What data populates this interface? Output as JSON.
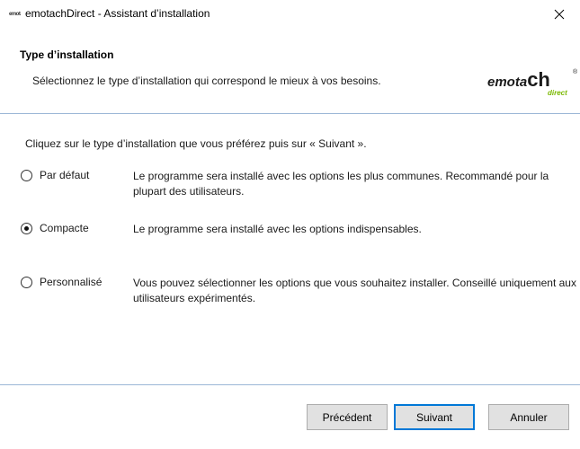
{
  "window": {
    "icon_text": "emotach",
    "title": "emotachDirect - Assistant d’installation"
  },
  "header": {
    "title": "Type d’installation",
    "subtitle": "Sélectionnez le type d’installation qui correspond le mieux à vos besoins."
  },
  "logo": {
    "word": "emota",
    "accent": "ch",
    "registered": "®",
    "sub": "direct"
  },
  "main": {
    "instruction": "Cliquez sur le type d’installation que vous préférez puis sur « Suivant ».",
    "options": [
      {
        "label": "Par défaut",
        "description": "Le programme sera installé avec les options les plus communes. Recommandé pour la plupart des utilisateurs.",
        "selected": false
      },
      {
        "label": "Compacte",
        "description": "Le programme sera installé avec les options indispensables.",
        "selected": true
      },
      {
        "label": "Personnalisé",
        "description": "Vous pouvez sélectionner les options que vous souhaitez installer. Conseillé uniquement aux utilisateurs expérimentés.",
        "selected": false
      }
    ]
  },
  "footer": {
    "back_label": "Précédent",
    "next_label": "Suivant",
    "cancel_label": "Annuler"
  },
  "colors": {
    "divider": "#9ab6d6",
    "default_button_border": "#0078d7",
    "logo_green": "#7ab800",
    "button_face": "#e1e1e1"
  },
  "icons": {
    "close": "close-icon",
    "app": "app-icon"
  }
}
